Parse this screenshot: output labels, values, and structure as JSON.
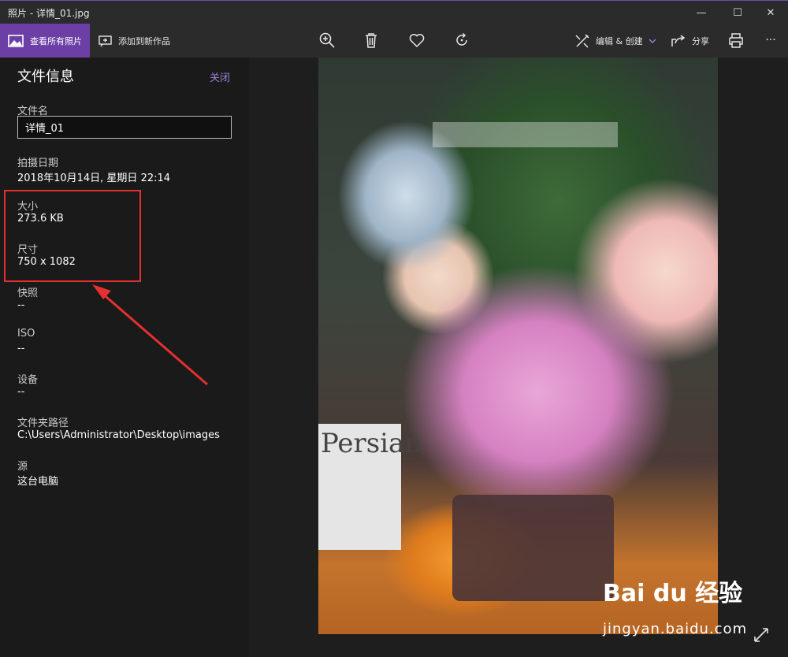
{
  "window": {
    "title": "照片 - 详情_01.jpg",
    "minimize": "—",
    "maximize": "☐",
    "close": "✕"
  },
  "toolbar": {
    "view_all": "查看所有照片",
    "add_to_creation": "添加到新作品",
    "edit_create": "编辑 & 创建",
    "share": "分享",
    "more": "···"
  },
  "panel": {
    "title": "文件信息",
    "close": "关闭",
    "filename_label": "文件名",
    "filename_value": "详情_01",
    "date_label": "拍摄日期",
    "date_value": "2018年10月14日, 星期日 22:14",
    "size_label": "大小",
    "size_value": "273.6 KB",
    "dimensions_label": "尺寸",
    "dimensions_value": "750 x 1082",
    "snapshot_label": "快照",
    "snapshot_value": "--",
    "iso_label": "ISO",
    "iso_value": "--",
    "device_label": "设备",
    "device_value": "--",
    "path_label": "文件夹路径",
    "path_value": "C:\\Users\\Administrator\\Desktop\\images",
    "source_label": "源",
    "source_value": "这台电脑"
  },
  "photo": {
    "book_text": "Persian"
  },
  "watermark": {
    "logo": "Bai du 经验",
    "url": "jingyan.baidu.com"
  },
  "colors": {
    "accent": "#6b3fa6",
    "highlight": "#e53030",
    "link": "#9b7fd8"
  }
}
